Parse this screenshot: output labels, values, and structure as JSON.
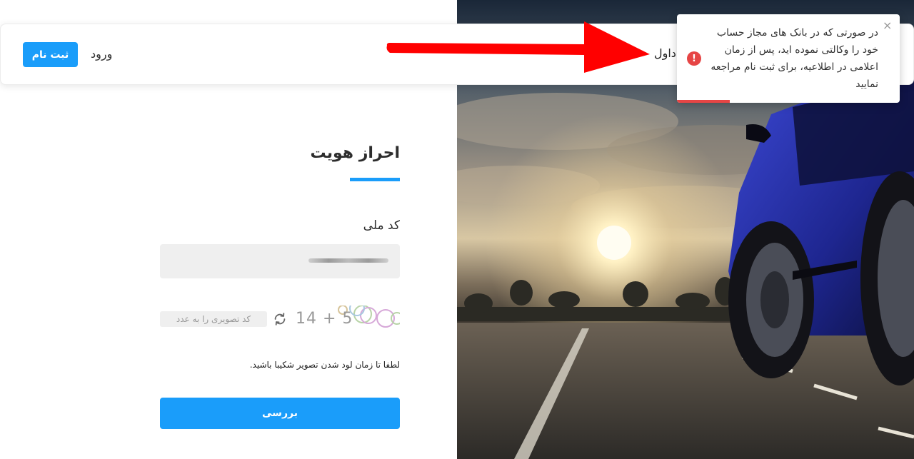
{
  "header": {
    "register_label": "ثبت نام",
    "login_label": "ورود",
    "partial_text": "داول"
  },
  "toast": {
    "message": "در صورتی که در بانک های مجاز حساب خود را وکالتی نموده اید، پس از زمان اعلامی در اطلاعیه، برای ثبت نام مراجعه نمایید",
    "close_label": "×",
    "icon_label": "!"
  },
  "auth": {
    "title": "احراز هویت",
    "national_code_label": "کد ملی",
    "captcha_placeholder": "کد تصویری را به عدد",
    "captcha_text": "14 + 5",
    "hint": "لطفا تا زمان لود شدن تصویر شکیبا باشید.",
    "submit_label": "بررسی"
  },
  "colors": {
    "accent": "#1a9dfa",
    "error": "#e64545",
    "annotation_arrow": "#ff0000"
  }
}
